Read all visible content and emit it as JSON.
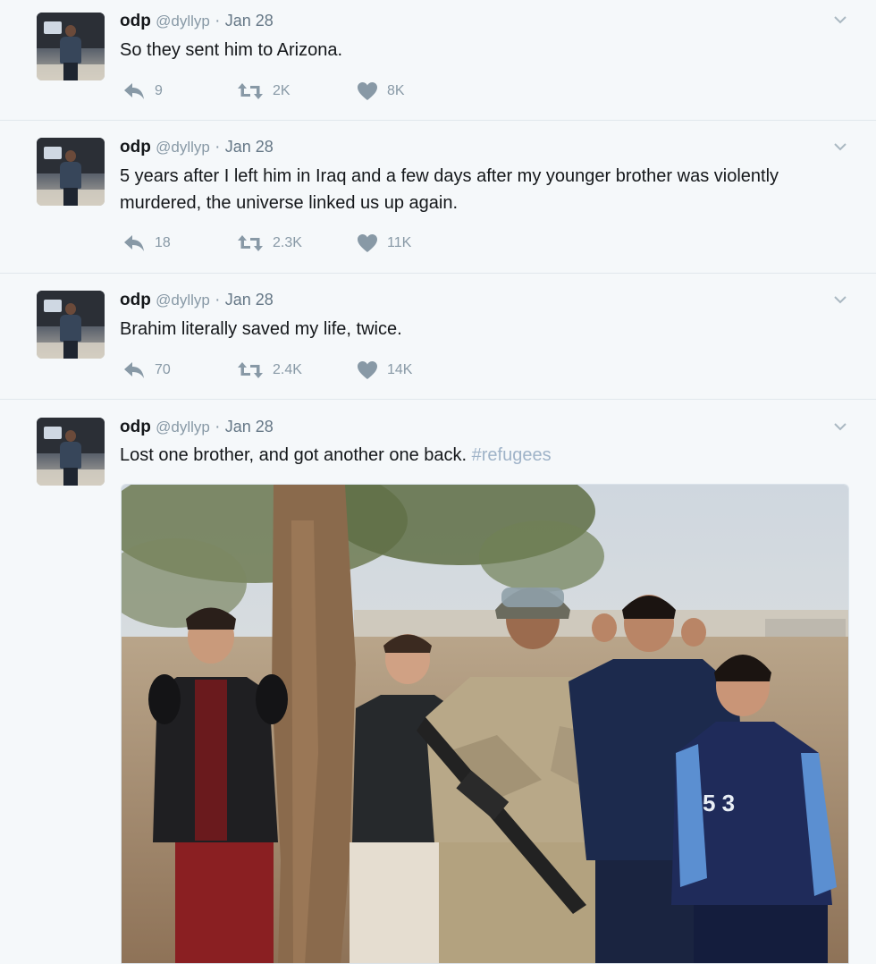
{
  "tweets": [
    {
      "name": "odp",
      "handle": "@dyllyp",
      "separator": "·",
      "date": "Jan 28",
      "text": "So they sent him to Arizona.",
      "hashtag": "",
      "replies": "9",
      "retweets": "2K",
      "likes": "8K"
    },
    {
      "name": "odp",
      "handle": "@dyllyp",
      "separator": "·",
      "date": "Jan 28",
      "text": "5 years after I left him in Iraq and a few days after my younger brother was violently murdered, the universe linked us up again.",
      "hashtag": "",
      "replies": "18",
      "retweets": "2.3K",
      "likes": "11K"
    },
    {
      "name": "odp",
      "handle": "@dyllyp",
      "separator": "·",
      "date": "Jan 28",
      "text": "Brahim literally saved my life, twice.",
      "hashtag": "",
      "replies": "70",
      "retweets": "2.4K",
      "likes": "14K"
    },
    {
      "name": "odp",
      "handle": "@dyllyp",
      "separator": "·",
      "date": "Jan 28",
      "text": "Lost one brother, and got another one back.",
      "hashtag": "#refugees"
    }
  ],
  "icons": {
    "reply": "reply-icon",
    "retweet": "retweet-icon",
    "like": "heart-icon",
    "caret": "chevron-down-icon",
    "avatar": "avatar-photo"
  },
  "colors": {
    "muted": "#8899a6",
    "background": "#f5f8fa",
    "divider": "#e1e8ed",
    "hashtag": "#9fb3c8"
  },
  "media": {
    "kind": "photo",
    "scene": "soldier-with-five-boys-under-tree"
  }
}
